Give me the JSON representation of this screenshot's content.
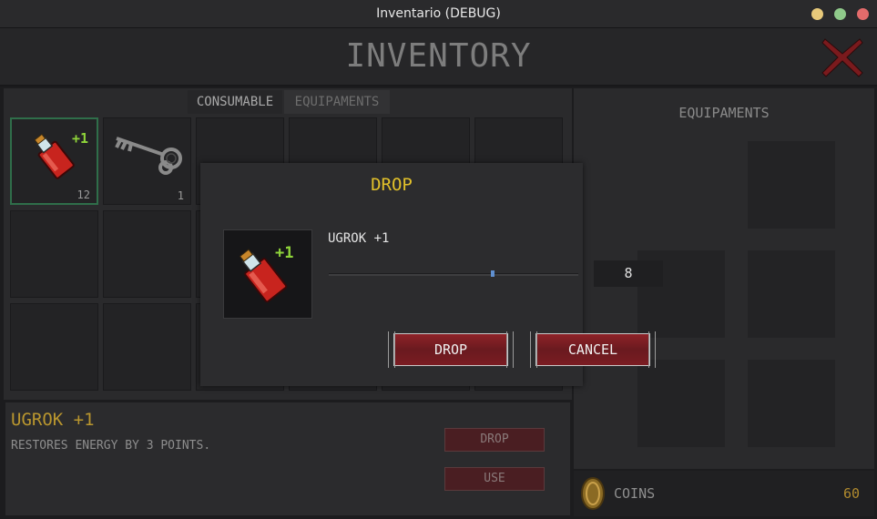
{
  "window": {
    "title": "Inventario (DEBUG)"
  },
  "header": {
    "title": "INVENTORY"
  },
  "tabs": [
    {
      "label": "CONSUMABLE",
      "active": true
    },
    {
      "label": "EQUIPAMENTS",
      "active": false
    }
  ],
  "slots": [
    {
      "item": "red-potion-icon",
      "badge": "+1",
      "count": "12",
      "selected": true
    },
    {
      "item": "key-icon",
      "count": "1",
      "selected": false
    }
  ],
  "info": {
    "name": "UGROK +1",
    "description": "RESTORES ENERGY BY 3 POINTS.",
    "drop_label": "DROP",
    "use_label": "USE"
  },
  "equipment_panel": {
    "title": "EQUIPAMENTS"
  },
  "coins": {
    "label": "COINS",
    "value": "60"
  },
  "modal": {
    "title": "DROP",
    "item_name": "UGROK +1",
    "item_badge": "+1",
    "quantity": "8",
    "drop_label": "DROP",
    "cancel_label": "CANCEL"
  },
  "colors": {
    "accent_yellow": "#e2c12a",
    "item_name_gold": "#b9962e",
    "button_red": "#7a1c22",
    "selected_border": "#2f6e4a"
  }
}
